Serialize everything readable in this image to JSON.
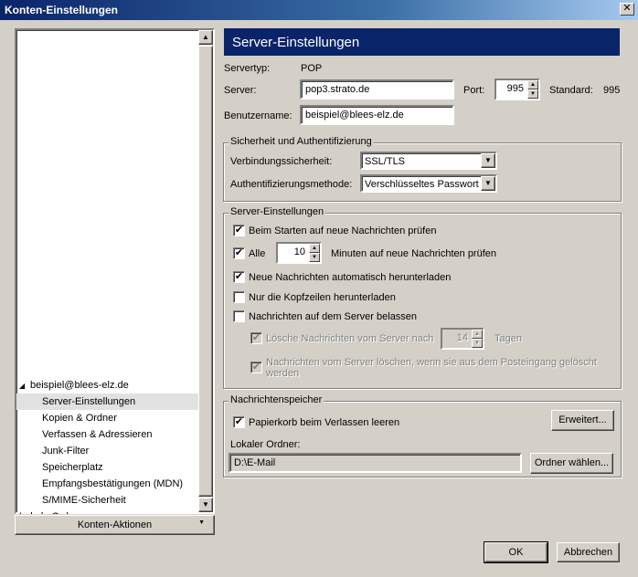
{
  "window": {
    "title": "Konten-Einstellungen",
    "close": "✕"
  },
  "tree": {
    "account": "beispiel@blees-elz.de",
    "items": [
      "Server-Einstellungen",
      "Kopien & Ordner",
      "Verfassen & Adressieren",
      "Junk-Filter",
      "Speicherplatz",
      "Empfangsbestätigungen (MDN)",
      "S/MIME-Sicherheit"
    ],
    "cut_off_item": "Lokale Ordner"
  },
  "account_actions_label": "Konten-Aktionen",
  "panel": {
    "title": "Server-Einstellungen",
    "servertype_label": "Servertyp:",
    "servertype_value": "POP",
    "server_label": "Server:",
    "server_value": "pop3.strato.de",
    "port_label": "Port:",
    "port_value": "995",
    "standard_label": "Standard:",
    "standard_value": "995",
    "username_label": "Benutzername:",
    "username_value": "beispiel@blees-elz.de"
  },
  "security": {
    "title": "Sicherheit und Authentifizierung",
    "connection_label": "Verbindungssicherheit:",
    "connection_value": "SSL/TLS",
    "auth_label": "Authentifizierungsmethode:",
    "auth_value": "Verschlüsseltes Passwort"
  },
  "settings": {
    "title": "Server-Einstellungen",
    "check_on_start": "Beim Starten auf neue Nachrichten prüfen",
    "check_every_label": "Alle",
    "check_every_value": "10",
    "check_every_suffix": "Minuten auf neue Nachrichten prüfen",
    "auto_download": "Neue Nachrichten automatisch herunterladen",
    "headers_only": "Nur die Kopfzeilen herunterladen",
    "leave_on_server": "Nachrichten auf dem Server belassen",
    "delete_after_label": "Lösche Nachrichten vom Server nach",
    "delete_after_value": "14",
    "delete_after_suffix": "Tagen",
    "delete_when_deleted": "Nachrichten vom Server löschen, wenn sie aus dem Posteingang gelöscht werden"
  },
  "storage": {
    "title": "Nachrichtenspeicher",
    "empty_trash": "Papierkorb beim Verlassen leeren",
    "advanced_button": "Erweitert...",
    "local_folder_label": "Lokaler Ordner:",
    "local_folder_value": "D:\\E-Mail",
    "choose_folder_button": "Ordner wählen..."
  },
  "dialog": {
    "ok": "OK",
    "cancel": "Abbrechen"
  },
  "glyphs": {
    "check": "✔",
    "up": "▲",
    "down": "▼",
    "expand": "◢"
  }
}
